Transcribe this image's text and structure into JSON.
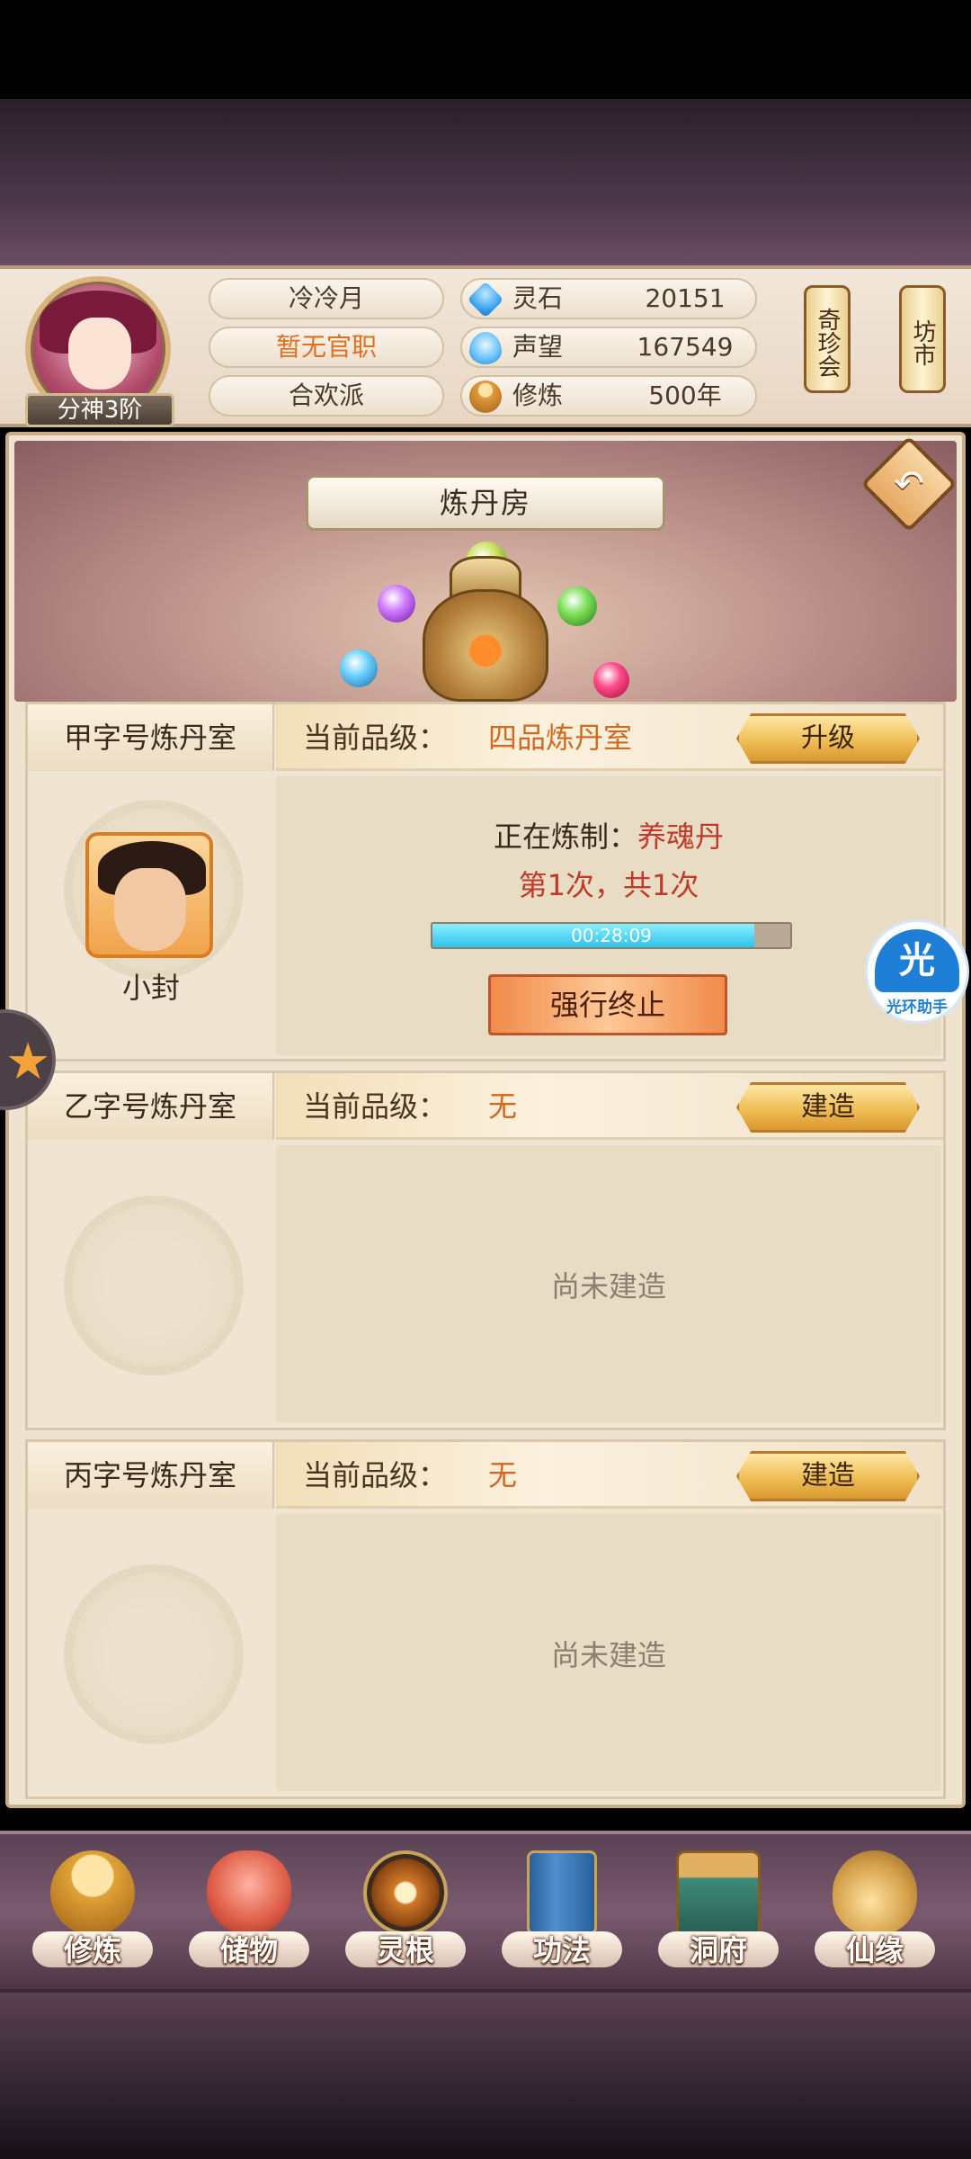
{
  "player": {
    "name": "冷冷月",
    "official_post": "暂无官职",
    "sect": "合欢派",
    "realm": "分神3阶"
  },
  "resources": [
    {
      "label": "灵石",
      "value": "20151",
      "icon": "spirit-stone-icon",
      "color": "#3fa9f5"
    },
    {
      "label": "声望",
      "value": "167549",
      "icon": "reputation-icon",
      "color": "#6ac3ff"
    },
    {
      "label": "修炼",
      "value": "500年",
      "icon": "meditation-icon",
      "color": "#e09a3a"
    }
  ],
  "side_buttons": {
    "treasure": "奇珍会",
    "market": "坊市"
  },
  "page": {
    "title": "炼丹房"
  },
  "rooms": [
    {
      "name": "甲字号炼丹室",
      "grade_label": "当前品级：",
      "grade_value": "四品炼丹室",
      "action": "升级",
      "worker_name": "小封",
      "crafting_label": "正在炼制：",
      "crafting_item": "养魂丹",
      "count_text": "第1次，共1次",
      "timer": "00:28:09",
      "progress": 0.9,
      "stop_label": "强行终止"
    },
    {
      "name": "乙字号炼丹室",
      "grade_label": "当前品级：",
      "grade_value": "无",
      "action": "建造",
      "empty_text": "尚未建造"
    },
    {
      "name": "丙字号炼丹室",
      "grade_label": "当前品级：",
      "grade_value": "无",
      "action": "建造",
      "empty_text": "尚未建造"
    }
  ],
  "assistant": {
    "glyph": "光",
    "label": "光环助手"
  },
  "nav": [
    {
      "label": "修炼",
      "icon": "meditation-icon",
      "color": "#e0a236"
    },
    {
      "label": "储物",
      "icon": "storage-bag-icon",
      "color": "#e0604a"
    },
    {
      "label": "灵根",
      "icon": "spirit-root-icon",
      "color": "#d07a2a"
    },
    {
      "label": "功法",
      "icon": "scripture-book-icon",
      "color": "#3f7fc0"
    },
    {
      "label": "洞府",
      "icon": "cave-mansion-icon",
      "color": "#c7923c"
    },
    {
      "label": "仙缘",
      "icon": "gourd-icon",
      "color": "#d4a04a"
    }
  ],
  "colors": {
    "accent_orange": "#d2691e",
    "accent_red": "#c0392b",
    "progress_cyan": "#2ec2ea"
  }
}
